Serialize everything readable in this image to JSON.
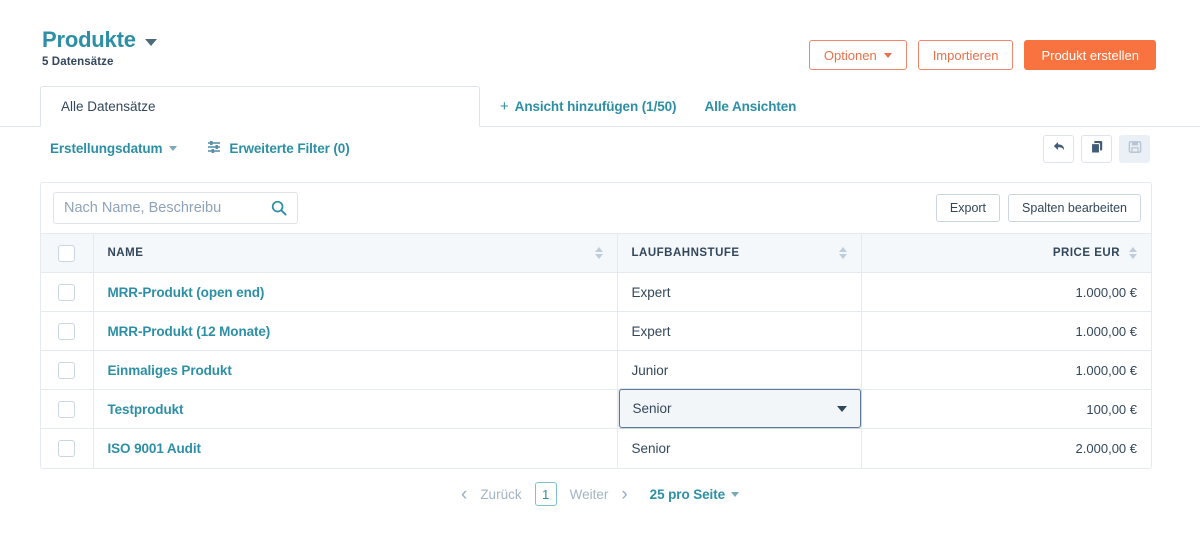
{
  "header": {
    "title": "Produkte",
    "record_count": "5 Datensätze",
    "title_caret_icon": "chevron-down-icon",
    "actions": {
      "options_label": "Optionen",
      "import_label": "Importieren",
      "create_label": "Produkt erstellen"
    }
  },
  "tabs": {
    "active_label": "Alle Datensätze",
    "add_view_label": "Ansicht hinzufügen (1/50)",
    "add_view_plus": "+",
    "all_views_label": "Alle Ansichten"
  },
  "filterbar": {
    "sort_label": "Erstellungsdatum",
    "advanced_filters_label": "Erweiterte Filter (0)",
    "advanced_filters_icon": "sliders-icon",
    "undo_icon": "undo-icon",
    "clone_icon": "clone-icon",
    "save_icon": "save-icon"
  },
  "toolbar": {
    "search_placeholder": "Nach Name, Beschreibu",
    "search_value": "",
    "search_icon": "search-icon",
    "export_label": "Export",
    "edit_columns_label": "Spalten bearbeiten"
  },
  "table": {
    "columns": [
      {
        "key": "name",
        "label": "NAME",
        "sortable": true
      },
      {
        "key": "stage",
        "label": "LAUFBAHNSTUFE",
        "sortable": true
      },
      {
        "key": "price",
        "label": "PRICE EUR",
        "sortable": true
      }
    ],
    "rows": [
      {
        "name": "MRR-Produkt (open end)",
        "stage": "Expert",
        "price": "1.000,00 €",
        "stage_active": false
      },
      {
        "name": "MRR-Produkt (12 Monate)",
        "stage": "Expert",
        "price": "1.000,00 €",
        "stage_active": false
      },
      {
        "name": "Einmaliges Produkt",
        "stage": "Junior",
        "price": "1.000,00 €",
        "stage_active": false
      },
      {
        "name": "Testprodukt",
        "stage": "Senior",
        "price": "100,00 €",
        "stage_active": true
      },
      {
        "name": "ISO 9001 Audit",
        "stage": "Senior",
        "price": "2.000,00 €",
        "stage_active": false
      }
    ]
  },
  "pagination": {
    "prev_chevron": "‹",
    "prev_label": "Zurück",
    "current_page": "1",
    "next_label": "Weiter",
    "next_chevron": "›",
    "page_size_label": "25 pro Seite"
  },
  "colors": {
    "teal": "#2d8fa5",
    "orange": "#f8733f",
    "orange_outline": "#e8704a",
    "navy": "#33475b",
    "border": "#dfe3eb",
    "header_bg": "#f5f8fa",
    "select_border": "#5c7999"
  }
}
